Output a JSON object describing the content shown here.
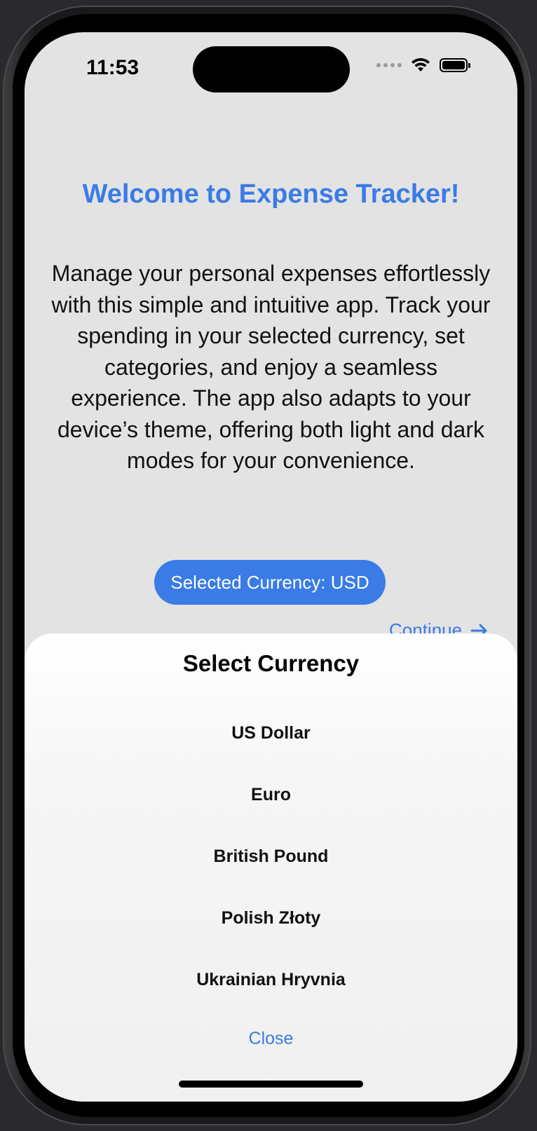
{
  "status_bar": {
    "time": "11:53",
    "icons": [
      "signal-icon",
      "wifi-icon",
      "battery-icon"
    ]
  },
  "welcome": {
    "title": "Welcome to Expense Tracker!",
    "description": "Manage your personal expenses effortlessly with this simple and intuitive app. Track your spending in your selected currency, set categories, and enjoy a seamless experience. The app also adapts to your device’s theme, offering both light and dark modes for your convenience."
  },
  "currency_button": {
    "label": "Selected Currency: USD"
  },
  "continue": {
    "label": "Continue",
    "icon": "arrow-right-icon"
  },
  "currency_sheet": {
    "title": "Select Currency",
    "options": [
      {
        "label": "US Dollar"
      },
      {
        "label": "Euro"
      },
      {
        "label": "British Pound"
      },
      {
        "label": "Polish Złoty"
      },
      {
        "label": "Ukrainian Hryvnia"
      }
    ],
    "close_label": "Close"
  },
  "colors": {
    "accent": "#3a7be6",
    "background": "#e3e3e3",
    "sheet": "#f5f5f5"
  }
}
